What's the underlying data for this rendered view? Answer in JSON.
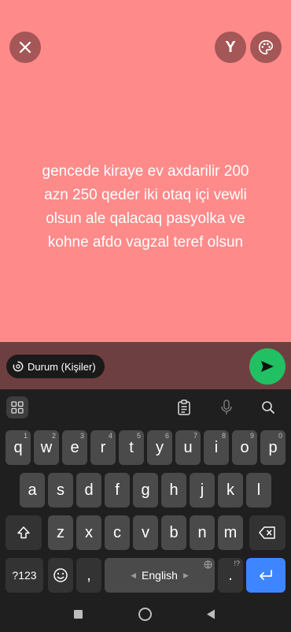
{
  "status": {
    "text": "gencede kiraye ev axdarilir 200\nazn 250 qeder iki otaq içi vewli\nolsun ale qalacaq pasyolka ve\nkohne afdo vagzal teref olsun",
    "background_color": "#ff8a8a"
  },
  "top_controls": {
    "close_icon": "close-icon",
    "font_button_label": "Y",
    "palette_icon": "palette-icon"
  },
  "composer": {
    "privacy_label": "Durum (Kişiler)",
    "send_icon": "send-icon",
    "send_color": "#21c063"
  },
  "keyboard": {
    "toolbar": [
      "grid-icon",
      "clipboard-icon",
      "mic-icon",
      "search-icon"
    ],
    "row1": [
      {
        "label": "q",
        "hint": "1"
      },
      {
        "label": "w",
        "hint": "2"
      },
      {
        "label": "e",
        "hint": "3"
      },
      {
        "label": "r",
        "hint": "4"
      },
      {
        "label": "t",
        "hint": "5"
      },
      {
        "label": "y",
        "hint": "6"
      },
      {
        "label": "u",
        "hint": "7"
      },
      {
        "label": "i",
        "hint": "8"
      },
      {
        "label": "o",
        "hint": "9"
      },
      {
        "label": "p",
        "hint": "0"
      }
    ],
    "row2": [
      "a",
      "s",
      "d",
      "f",
      "g",
      "h",
      "j",
      "k",
      "l"
    ],
    "row3": [
      "z",
      "x",
      "c",
      "v",
      "b",
      "n",
      "m"
    ],
    "numbers_label": "?123",
    "comma_label": ",",
    "space_label": "English",
    "period_label": ".",
    "period_hint": "!?",
    "accent_color": "#3e86ff"
  },
  "navbar": [
    "recents-icon",
    "home-icon",
    "back-icon"
  ]
}
